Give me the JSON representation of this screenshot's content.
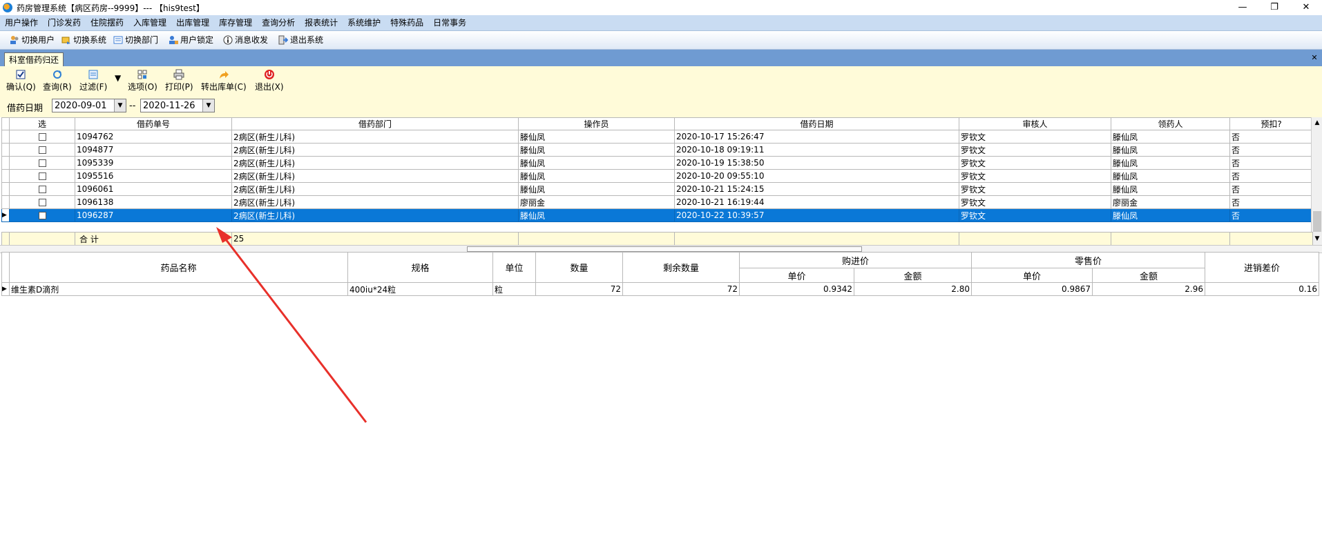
{
  "window": {
    "title": "药房管理系统【病区药房--9999】--- 【his9test】",
    "minimize": "—",
    "restore": "❐",
    "close": "✕"
  },
  "menu": [
    "用户操作",
    "门诊发药",
    "住院摆药",
    "入库管理",
    "出库管理",
    "库存管理",
    "查询分析",
    "报表统计",
    "系统维护",
    "特殊药品",
    "日常事务"
  ],
  "toolbar": {
    "switch_user": "切换用户",
    "switch_system": "切换系统",
    "switch_dept": "切换部门",
    "lock_user": "用户锁定",
    "messages": "消息收发",
    "exit_system": "退出系统"
  },
  "tab": {
    "label": "科室借药归还",
    "close": "✕"
  },
  "actions": {
    "confirm": "确认(Q)",
    "query": "查询(R)",
    "filter": "过滤(F)",
    "options": "选项(O)",
    "print": "打印(P)",
    "to_outbound": "转出库单(C)",
    "exit": "退出(X)"
  },
  "date_filter": {
    "label": "借药日期",
    "from": "2020-09-01",
    "separator": "--",
    "to": "2020-11-26"
  },
  "borrow_grid": {
    "headers": [
      "选",
      "借药单号",
      "借药部门",
      "操作员",
      "借药日期",
      "审核人",
      "领药人",
      "预扣?"
    ],
    "rows": [
      {
        "no": "1094762",
        "dept": "2病区(新生儿科)",
        "operator": "滕仙凤",
        "date": "2020-10-17 15:26:47",
        "auditor": "罗钦文",
        "receiver": "滕仙凤",
        "prededuct": "否"
      },
      {
        "no": "1094877",
        "dept": "2病区(新生儿科)",
        "operator": "滕仙凤",
        "date": "2020-10-18 09:19:11",
        "auditor": "罗钦文",
        "receiver": "滕仙凤",
        "prededuct": "否"
      },
      {
        "no": "1095339",
        "dept": "2病区(新生儿科)",
        "operator": "滕仙凤",
        "date": "2020-10-19 15:38:50",
        "auditor": "罗钦文",
        "receiver": "滕仙凤",
        "prededuct": "否"
      },
      {
        "no": "1095516",
        "dept": "2病区(新生儿科)",
        "operator": "滕仙凤",
        "date": "2020-10-20 09:55:10",
        "auditor": "罗钦文",
        "receiver": "滕仙凤",
        "prededuct": "否"
      },
      {
        "no": "1096061",
        "dept": "2病区(新生儿科)",
        "operator": "滕仙凤",
        "date": "2020-10-21 15:24:15",
        "auditor": "罗钦文",
        "receiver": "滕仙凤",
        "prededuct": "否"
      },
      {
        "no": "1096138",
        "dept": "2病区(新生儿科)",
        "operator": "廖丽金",
        "date": "2020-10-21 16:19:44",
        "auditor": "罗钦文",
        "receiver": "廖丽金",
        "prededuct": "否"
      },
      {
        "no": "1096287",
        "dept": "2病区(新生儿科)",
        "operator": "滕仙凤",
        "date": "2020-10-22 10:39:57",
        "auditor": "罗钦文",
        "receiver": "滕仙凤",
        "prededuct": "否"
      }
    ],
    "selected_index": 6,
    "summary_label": "合  计",
    "summary_value": "25"
  },
  "detail_grid": {
    "headers": {
      "name": "药品名称",
      "spec": "规格",
      "unit": "单位",
      "qty": "数量",
      "remaining": "剩余数量",
      "purchase": "购进价",
      "retail": "零售价",
      "unit_price": "单价",
      "amount": "金额",
      "diff": "进销差价"
    },
    "rows": [
      {
        "name": "维生素D滴剂",
        "spec": "400iu*24粒",
        "unit": "粒",
        "qty": "72",
        "remaining": "72",
        "p_price": "0.9342",
        "p_amount": "2.80",
        "r_price": "0.9867",
        "r_amount": "2.96",
        "diff": "0.16"
      }
    ]
  },
  "colors": {
    "menubar": "#c9dcf2",
    "selection": "#0a78d7",
    "panel": "#fffbd9",
    "tabstrip": "#6f9bd2",
    "annotation_arrow": "#e8302a"
  }
}
